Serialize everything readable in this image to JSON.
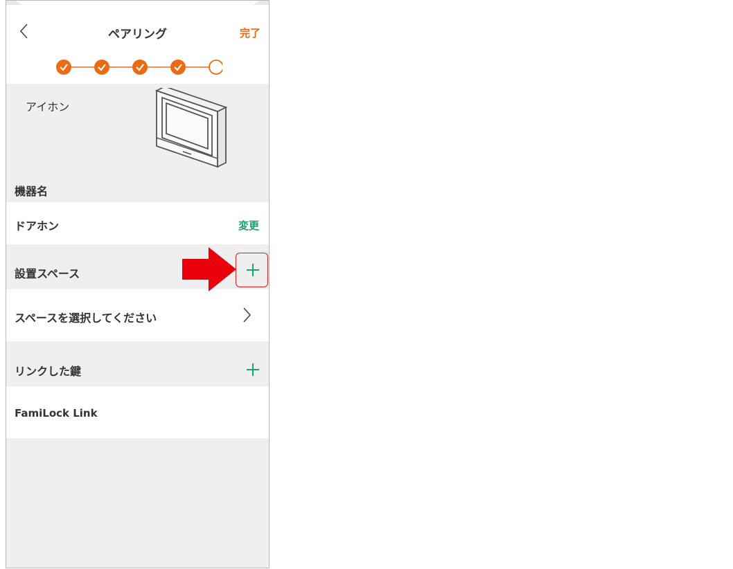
{
  "header": {
    "title": "ペアリング",
    "done_label": "完了",
    "steps_done": 4,
    "steps_total": 5
  },
  "device": {
    "name": "アイホン"
  },
  "device_name_section": {
    "label": "機器名",
    "value": "ドアホン",
    "change_label": "変更"
  },
  "space_section": {
    "label": "設置スペース",
    "placeholder": "スペースを選択してください"
  },
  "lock_section": {
    "label": "リンクした鍵",
    "item": "FamiLock Link"
  },
  "colors": {
    "accent_orange": "#ea6b14",
    "accent_green": "#1aa36a",
    "highlight_red": "#e21b1b"
  }
}
